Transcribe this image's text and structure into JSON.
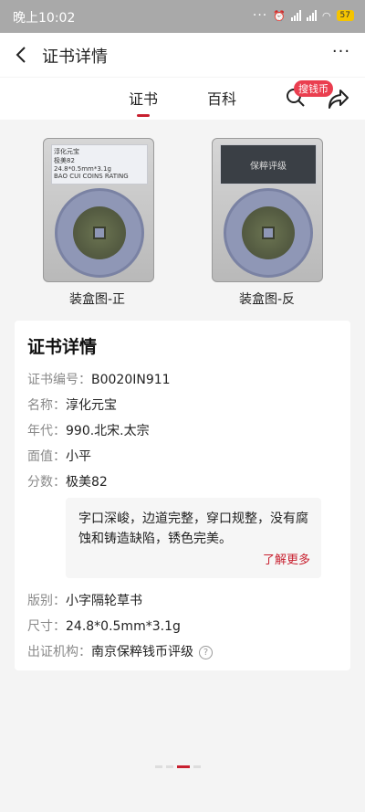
{
  "status_bar": {
    "time": "晚上10:02",
    "signal_1": "HD",
    "signal_2": "HD",
    "battery": "57"
  },
  "header": {
    "title": "证书详情"
  },
  "tabs": {
    "cert": "证书",
    "wiki": "百科"
  },
  "search": {
    "badge": "搜钱币"
  },
  "images": {
    "front_caption": "装盒图-正",
    "back_caption": "装盒图-反",
    "front_label_lines": [
      "淳化元宝",
      "极美82",
      "24.8*0.5mm*3.1g",
      "BAO CUI COINS RATING"
    ],
    "back_label_lines": [
      "保粹评级"
    ]
  },
  "details": {
    "title": "证书详情",
    "rows": [
      {
        "key": "证书编号：",
        "value": "B0020IN911"
      },
      {
        "key": "名称：",
        "value": "淳化元宝"
      },
      {
        "key": "年代：",
        "value": "990.北宋.太宗"
      },
      {
        "key": "面值：",
        "value": "小平"
      },
      {
        "key": "分数：",
        "value": "极美82"
      }
    ],
    "description": "字口深峻，边道完整，穿口规整，没有腐蚀和铸造缺陷，锈色完美。",
    "learn_more": "了解更多",
    "rows_after": [
      {
        "key": "版别：",
        "value": "小字隔轮草书"
      },
      {
        "key": "尺寸：",
        "value": "24.8*0.5mm*3.1g"
      },
      {
        "key": "出证机构：",
        "value": "南京保粹钱币评级"
      }
    ]
  },
  "colors": {
    "accent": "#c8202f",
    "badge": "#ea3e4f"
  }
}
